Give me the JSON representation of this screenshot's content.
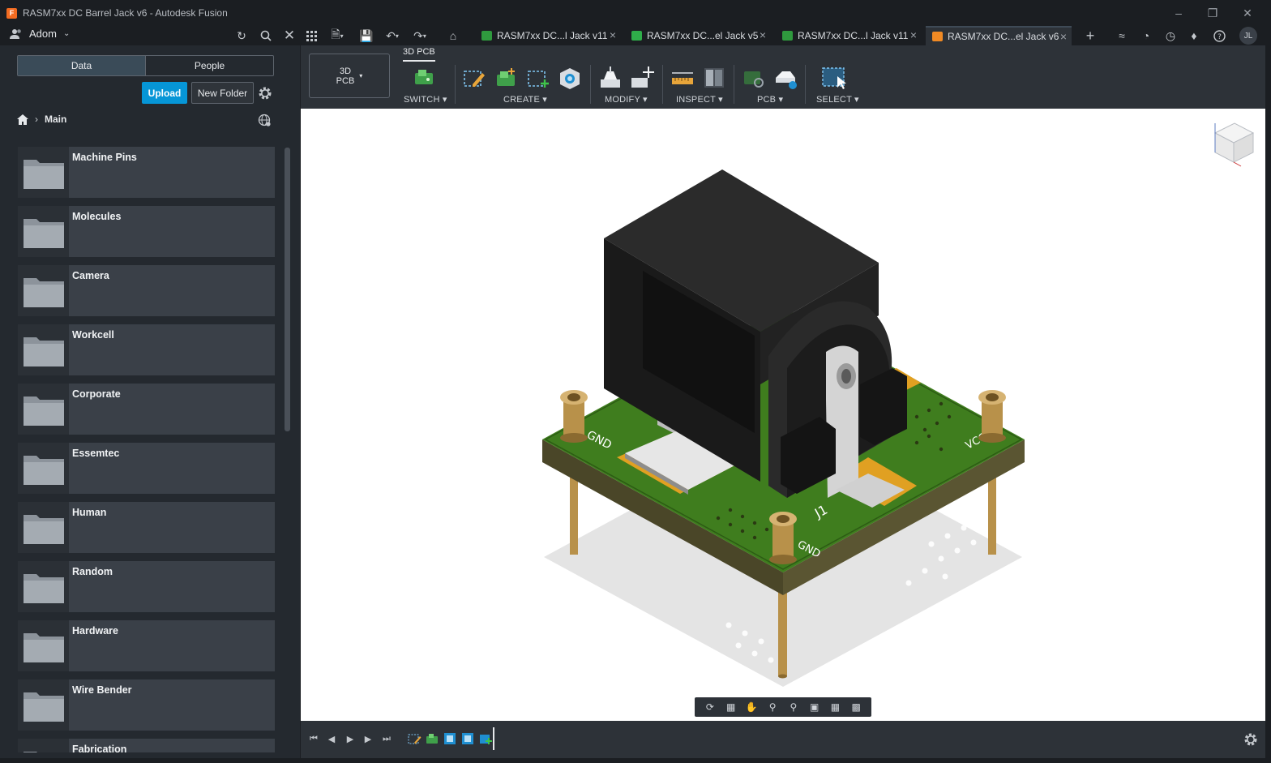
{
  "window": {
    "title": "RASM7xx DC Barrel Jack v6 - Autodesk Fusion"
  },
  "topbar": {
    "team_name": "Adom",
    "avatar_initials": "JL"
  },
  "tabs": [
    {
      "label": "RASM7xx DC...l Jack v11",
      "active": false
    },
    {
      "label": "RASM7xx DC...el Jack v5",
      "active": false
    },
    {
      "label": "RASM7xx DC...l Jack v11",
      "active": false
    },
    {
      "label": "RASM7xx DC...el Jack v6",
      "active": true
    }
  ],
  "sidebar": {
    "tabs": [
      "Data",
      "People"
    ],
    "upload_label": "Upload",
    "new_folder_label": "New Folder",
    "breadcrumb": "Main",
    "folders": [
      "Machine Pins",
      "Molecules",
      "Camera",
      "Workcell",
      "Corporate",
      "Essemtec",
      "Human",
      "Random",
      "Hardware",
      "Wire Bender",
      "Fabrication"
    ]
  },
  "toolbar": {
    "workspace_label_line1": "3D",
    "workspace_label_line2": "PCB",
    "workspace_tab": "3D PCB",
    "groups": [
      "SWITCH",
      "CREATE",
      "MODIFY",
      "INSPECT",
      "PCB",
      "SELECT"
    ]
  },
  "board": {
    "silkscreen": [
      "GND",
      "J1",
      "GND",
      "VCC"
    ]
  },
  "colors": {
    "accent": "#0696d7",
    "pcb_green": "#3f7d1e",
    "connector_black": "#1a1a1a",
    "brass": "#b8914a",
    "pad_gold": "#e0a022"
  }
}
